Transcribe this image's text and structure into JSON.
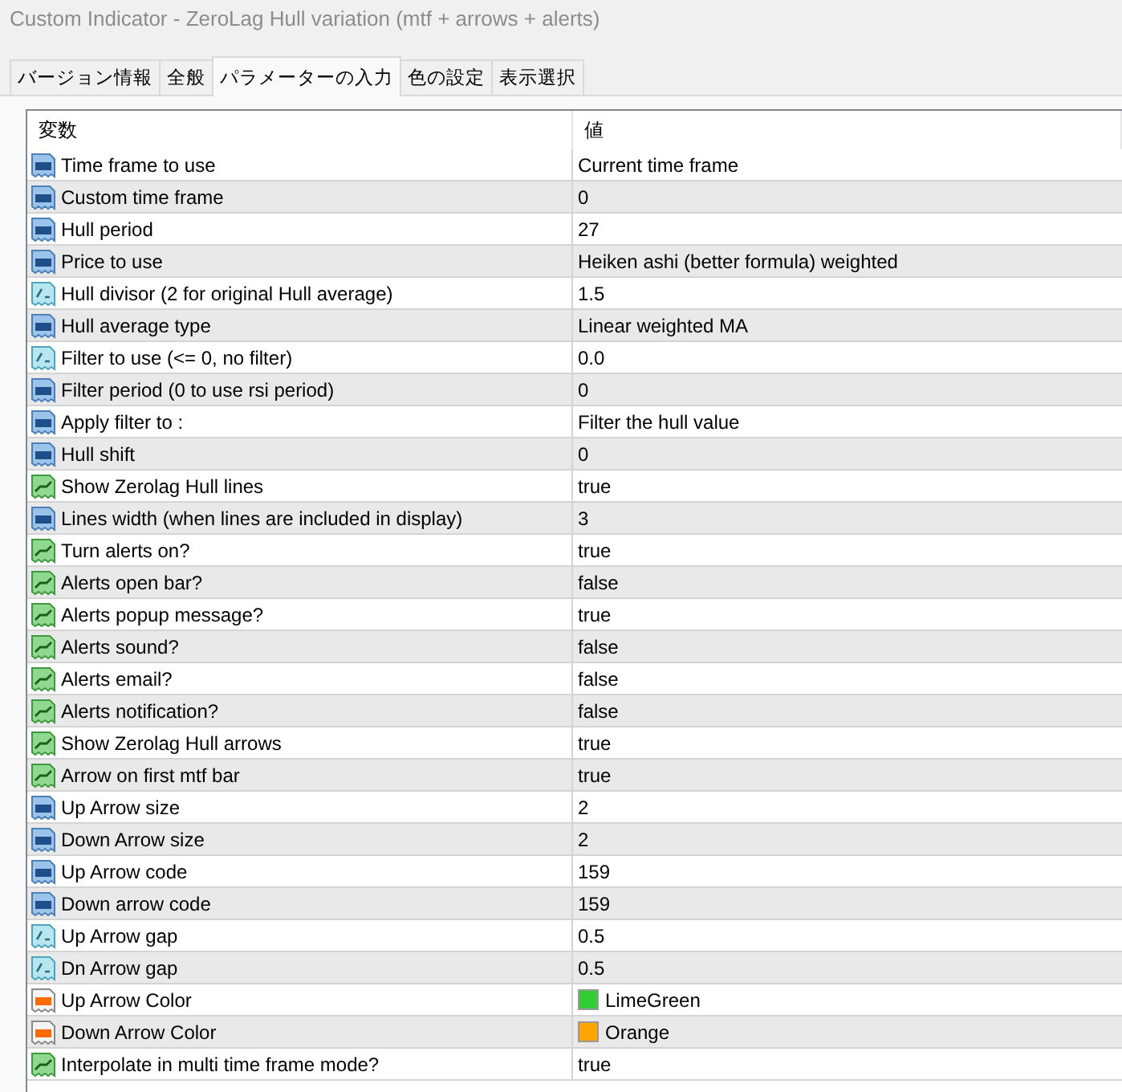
{
  "window": {
    "title": "Custom Indicator - ZeroLag Hull variation (mtf + arrows + alerts)"
  },
  "tabs": [
    {
      "label": "バージョン情報",
      "selected": false
    },
    {
      "label": "全般",
      "selected": false
    },
    {
      "label": "パラメーターの入力",
      "selected": true
    },
    {
      "label": "色の設定",
      "selected": false
    },
    {
      "label": "表示選択",
      "selected": false
    }
  ],
  "table": {
    "columns": [
      "変数",
      "値"
    ],
    "rows": [
      {
        "kind": "int",
        "name": "Time frame to use",
        "value": "Current time frame"
      },
      {
        "kind": "int",
        "name": "Custom time frame",
        "value": "0"
      },
      {
        "kind": "int",
        "name": "Hull period",
        "value": "27"
      },
      {
        "kind": "int",
        "name": "Price to use",
        "value": "Heiken ashi (better formula) weighted"
      },
      {
        "kind": "double",
        "name": "Hull divisor (2 for original Hull average)",
        "value": "1.5"
      },
      {
        "kind": "int",
        "name": "Hull average type",
        "value": "Linear weighted MA"
      },
      {
        "kind": "double",
        "name": "Filter to use (<= 0, no filter)",
        "value": "0.0"
      },
      {
        "kind": "int",
        "name": "Filter period (0 to use rsi period)",
        "value": "0"
      },
      {
        "kind": "int",
        "name": "Apply filter to :",
        "value": "Filter the hull value"
      },
      {
        "kind": "int",
        "name": "Hull shift",
        "value": "0"
      },
      {
        "kind": "bool",
        "name": "Show Zerolag Hull lines",
        "value": "true"
      },
      {
        "kind": "int",
        "name": "Lines width (when lines are included in display)",
        "value": "3"
      },
      {
        "kind": "bool",
        "name": "Turn alerts on?",
        "value": "true"
      },
      {
        "kind": "bool",
        "name": "Alerts open bar?",
        "value": "false"
      },
      {
        "kind": "bool",
        "name": "Alerts popup message?",
        "value": "true"
      },
      {
        "kind": "bool",
        "name": "Alerts sound?",
        "value": "false"
      },
      {
        "kind": "bool",
        "name": "Alerts email?",
        "value": "false"
      },
      {
        "kind": "bool",
        "name": "Alerts notification?",
        "value": "false"
      },
      {
        "kind": "bool",
        "name": "Show Zerolag Hull arrows",
        "value": "true"
      },
      {
        "kind": "bool",
        "name": "Arrow on first mtf bar",
        "value": "true"
      },
      {
        "kind": "int",
        "name": "Up Arrow size",
        "value": "2"
      },
      {
        "kind": "int",
        "name": "Down Arrow size",
        "value": "2"
      },
      {
        "kind": "int",
        "name": "Up Arrow code",
        "value": "159"
      },
      {
        "kind": "int",
        "name": "Down arrow code",
        "value": "159"
      },
      {
        "kind": "double",
        "name": "Up Arrow gap",
        "value": "0.5"
      },
      {
        "kind": "double",
        "name": "Dn Arrow gap",
        "value": "0.5"
      },
      {
        "kind": "color",
        "name": "Up Arrow Color",
        "value": "LimeGreen",
        "color": "#32cd32"
      },
      {
        "kind": "color",
        "name": "Down Arrow Color",
        "value": "Orange",
        "color": "#ffa500"
      },
      {
        "kind": "bool",
        "name": "Interpolate in multi time frame mode?",
        "value": "true"
      }
    ]
  }
}
